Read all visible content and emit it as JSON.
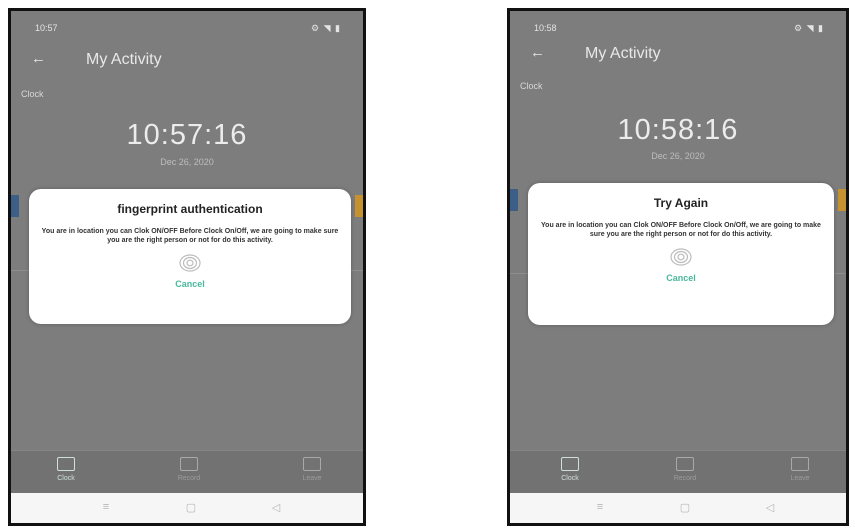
{
  "screens": [
    {
      "status_time": "10:57",
      "status_icons": "⚙ ◥ ▮",
      "title": "My Activity",
      "section_label": "Clock",
      "clock": "10:57:16",
      "date": "Dec 26, 2020",
      "dialog": {
        "title": "fingerprint authentication",
        "body": "You are in location you can Clok ON/OFF Before Clock On/Off, we are going to make sure you are the right person or not for do this activity.",
        "cancel": "Cancel"
      },
      "nav": [
        "Clock",
        "Record",
        "Leave"
      ],
      "icons": {
        "back": "back-arrow-icon",
        "fingerprint": "fingerprint-icon"
      }
    },
    {
      "status_time": "10:58",
      "status_icons": "⚙ ◥ ▮",
      "title": "My Activity",
      "section_label": "Clock",
      "clock": "10:58:16",
      "date": "Dec 26, 2020",
      "dialog": {
        "title": "Try Again",
        "body": "You are in location you can Clok ON/OFF Before Clock On/Off, we are going to make sure you are the right person or not for do this activity.",
        "cancel": "Cancel"
      },
      "nav": [
        "Clock",
        "Record",
        "Leave"
      ],
      "icons": {
        "back": "back-arrow-icon",
        "fingerprint": "fingerprint-icon"
      }
    }
  ],
  "system_nav": {
    "recent": "≡",
    "home": "▢",
    "back": "◁"
  },
  "colors": {
    "accent": "#48b89a",
    "overlay": "#7d7d7d",
    "tab_blue": "#3b5f86",
    "tab_orange": "#c6912f"
  }
}
